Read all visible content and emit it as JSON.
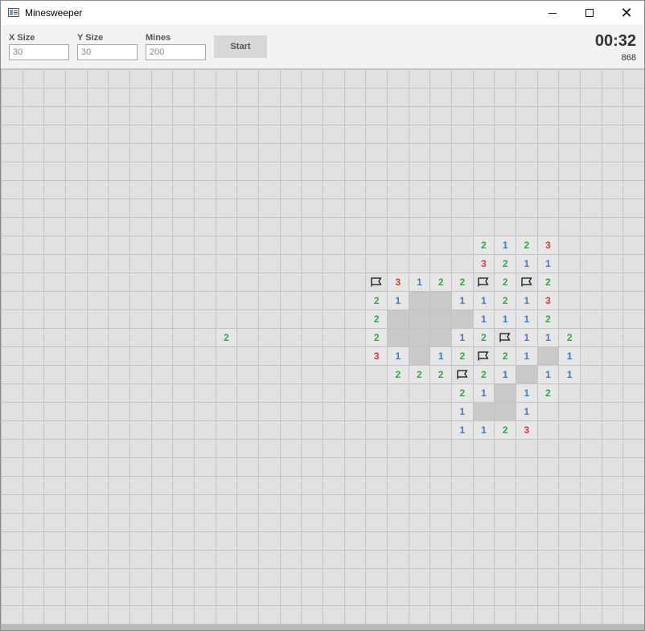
{
  "window": {
    "title": "Minesweeper",
    "minimize": "",
    "maximize": "",
    "close": "✕"
  },
  "toolbar": {
    "x_size": {
      "label": "X Size",
      "value": "30"
    },
    "y_size": {
      "label": "Y Size",
      "value": "30"
    },
    "mines": {
      "label": "Mines",
      "value": "200"
    },
    "start_label": "Start",
    "timer": "00:32",
    "counter": "868"
  },
  "board": {
    "cols": 30,
    "rows": 30,
    "revealed": [
      {
        "row": 9,
        "col": 22,
        "v": "2"
      },
      {
        "row": 9,
        "col": 23,
        "v": "1"
      },
      {
        "row": 9,
        "col": 24,
        "v": "2"
      },
      {
        "row": 9,
        "col": 25,
        "v": "3"
      },
      {
        "row": 10,
        "col": 22,
        "v": "3"
      },
      {
        "row": 10,
        "col": 23,
        "v": "2"
      },
      {
        "row": 10,
        "col": 24,
        "v": "1"
      },
      {
        "row": 10,
        "col": 25,
        "v": "1"
      },
      {
        "row": 11,
        "col": 17,
        "v": "F"
      },
      {
        "row": 11,
        "col": 18,
        "v": "3"
      },
      {
        "row": 11,
        "col": 19,
        "v": "1"
      },
      {
        "row": 11,
        "col": 20,
        "v": "2"
      },
      {
        "row": 11,
        "col": 21,
        "v": "2"
      },
      {
        "row": 11,
        "col": 22,
        "v": "F"
      },
      {
        "row": 11,
        "col": 23,
        "v": "2"
      },
      {
        "row": 11,
        "col": 24,
        "v": "F"
      },
      {
        "row": 11,
        "col": 25,
        "v": "2"
      },
      {
        "row": 12,
        "col": 17,
        "v": "2"
      },
      {
        "row": 12,
        "col": 18,
        "v": "1"
      },
      {
        "row": 12,
        "col": 19,
        "v": ""
      },
      {
        "row": 12,
        "col": 20,
        "v": ""
      },
      {
        "row": 12,
        "col": 21,
        "v": "1"
      },
      {
        "row": 12,
        "col": 22,
        "v": "1"
      },
      {
        "row": 12,
        "col": 23,
        "v": "2"
      },
      {
        "row": 12,
        "col": 24,
        "v": "1"
      },
      {
        "row": 12,
        "col": 25,
        "v": "3"
      },
      {
        "row": 13,
        "col": 17,
        "v": "2"
      },
      {
        "row": 13,
        "col": 18,
        "v": ""
      },
      {
        "row": 13,
        "col": 19,
        "v": ""
      },
      {
        "row": 13,
        "col": 20,
        "v": ""
      },
      {
        "row": 13,
        "col": 21,
        "v": ""
      },
      {
        "row": 13,
        "col": 22,
        "v": "1"
      },
      {
        "row": 13,
        "col": 23,
        "v": "1"
      },
      {
        "row": 13,
        "col": 24,
        "v": "1"
      },
      {
        "row": 13,
        "col": 25,
        "v": "2"
      },
      {
        "row": 14,
        "col": 10,
        "v": "2"
      },
      {
        "row": 14,
        "col": 17,
        "v": "2"
      },
      {
        "row": 14,
        "col": 18,
        "v": ""
      },
      {
        "row": 14,
        "col": 19,
        "v": ""
      },
      {
        "row": 14,
        "col": 20,
        "v": ""
      },
      {
        "row": 14,
        "col": 21,
        "v": "1"
      },
      {
        "row": 14,
        "col": 22,
        "v": "2"
      },
      {
        "row": 14,
        "col": 23,
        "v": "F"
      },
      {
        "row": 14,
        "col": 24,
        "v": "1"
      },
      {
        "row": 14,
        "col": 25,
        "v": "1"
      },
      {
        "row": 14,
        "col": 26,
        "v": "2"
      },
      {
        "row": 15,
        "col": 17,
        "v": "3"
      },
      {
        "row": 15,
        "col": 18,
        "v": "1"
      },
      {
        "row": 15,
        "col": 19,
        "v": ""
      },
      {
        "row": 15,
        "col": 20,
        "v": "1"
      },
      {
        "row": 15,
        "col": 21,
        "v": "2"
      },
      {
        "row": 15,
        "col": 22,
        "v": "F"
      },
      {
        "row": 15,
        "col": 23,
        "v": "2"
      },
      {
        "row": 15,
        "col": 24,
        "v": "1"
      },
      {
        "row": 15,
        "col": 25,
        "v": ""
      },
      {
        "row": 15,
        "col": 26,
        "v": "1"
      },
      {
        "row": 16,
        "col": 18,
        "v": "2"
      },
      {
        "row": 16,
        "col": 19,
        "v": "2"
      },
      {
        "row": 16,
        "col": 20,
        "v": "2"
      },
      {
        "row": 16,
        "col": 21,
        "v": "F"
      },
      {
        "row": 16,
        "col": 22,
        "v": "2"
      },
      {
        "row": 16,
        "col": 23,
        "v": "1"
      },
      {
        "row": 16,
        "col": 24,
        "v": ""
      },
      {
        "row": 16,
        "col": 25,
        "v": "1"
      },
      {
        "row": 16,
        "col": 26,
        "v": "1"
      },
      {
        "row": 17,
        "col": 21,
        "v": "2"
      },
      {
        "row": 17,
        "col": 22,
        "v": "1"
      },
      {
        "row": 17,
        "col": 23,
        "v": ""
      },
      {
        "row": 17,
        "col": 24,
        "v": "1"
      },
      {
        "row": 17,
        "col": 25,
        "v": "2"
      },
      {
        "row": 18,
        "col": 21,
        "v": "1"
      },
      {
        "row": 18,
        "col": 22,
        "v": ""
      },
      {
        "row": 18,
        "col": 23,
        "v": ""
      },
      {
        "row": 18,
        "col": 24,
        "v": "1"
      },
      {
        "row": 19,
        "col": 21,
        "v": "1"
      },
      {
        "row": 19,
        "col": 22,
        "v": "1"
      },
      {
        "row": 19,
        "col": 23,
        "v": "2"
      },
      {
        "row": 19,
        "col": 24,
        "v": "3"
      }
    ]
  }
}
